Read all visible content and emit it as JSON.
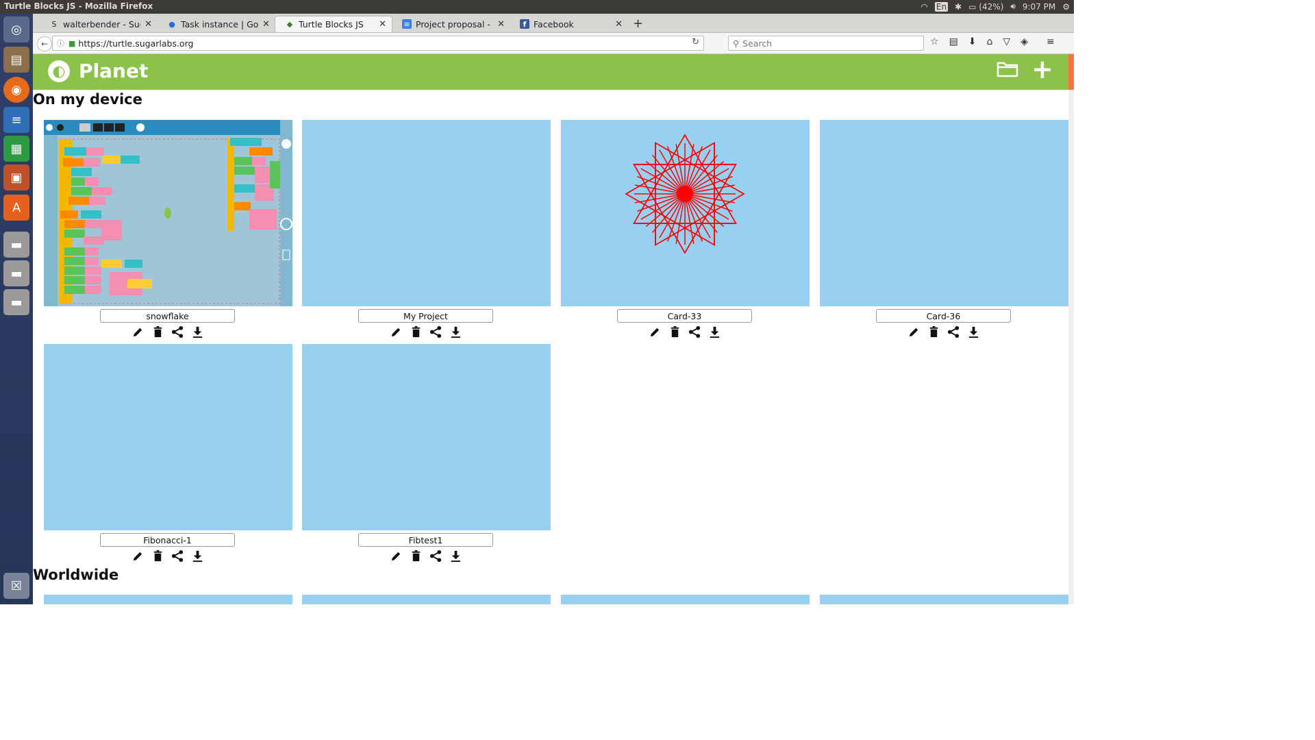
{
  "window": {
    "title": "Turtle Blocks JS - Mozilla Firefox"
  },
  "tray": {
    "keyboard": "En",
    "battery": "(42%)",
    "time": "9:07 PM"
  },
  "tabs": [
    {
      "label": "walterbender - Sug…",
      "icon": "sugarlabs-favicon"
    },
    {
      "label": "Task instance | Goo…",
      "icon": "google-code-in-favicon"
    },
    {
      "label": "Turtle Blocks JS",
      "icon": "turtle-favicon"
    },
    {
      "label": "Project proposal - G…",
      "icon": "google-docs-favicon"
    },
    {
      "label": "Facebook",
      "icon": "facebook-favicon"
    }
  ],
  "urlbar": {
    "url": "https://turtle.sugarlabs.org"
  },
  "search": {
    "placeholder": "Search"
  },
  "planet": {
    "title": "Planet"
  },
  "sections": {
    "local": "On my device",
    "global": "Worldwide"
  },
  "projects": [
    {
      "name": "snowflake",
      "thumbnail": "turtle-blocks-workspace"
    },
    {
      "name": "My Project",
      "thumbnail": "blank"
    },
    {
      "name": "Card-33",
      "thumbnail": "red-spirograph"
    },
    {
      "name": "Card-36",
      "thumbnail": "blank"
    },
    {
      "name": "Fibonacci-1",
      "thumbnail": "blank"
    },
    {
      "name": "Fibtest1",
      "thumbnail": "blank"
    }
  ],
  "colors": {
    "header_green": "#8bc34a",
    "thumb_blue": "#97d0f0",
    "spiro_red": "#ff0000"
  }
}
